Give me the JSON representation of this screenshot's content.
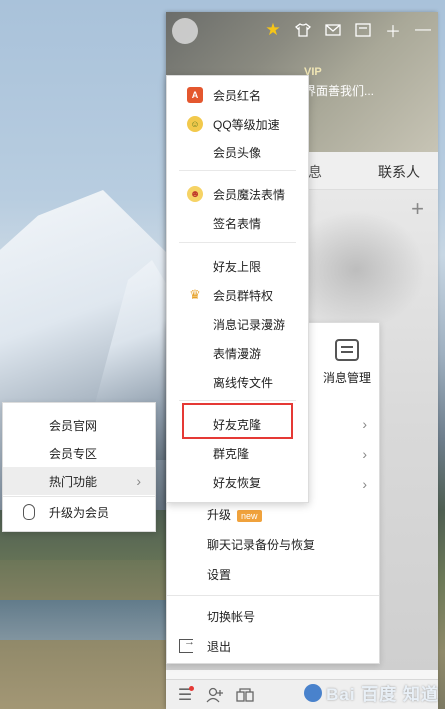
{
  "window": {
    "titlebar_icons": [
      "star-icon",
      "shirt-icon",
      "mail-icon",
      "mailbox-icon",
      "plus-icon",
      "minimize-icon"
    ],
    "vip_tag": "VIP",
    "signature": "界面善我们...",
    "tab_partial": "息",
    "tab_contacts": "联系人"
  },
  "main_menu": {
    "message_manager": "消息管理",
    "items": [
      {
        "label": "",
        "has_submenu": true
      },
      {
        "label": "",
        "has_submenu": true
      },
      {
        "label": "",
        "has_submenu": true
      },
      {
        "label": "升级",
        "badge": "new"
      },
      {
        "label": "聊天记录备份与恢复"
      },
      {
        "label": "设置"
      },
      {
        "label": "切换帐号"
      },
      {
        "label": "退出"
      }
    ]
  },
  "left_menu": {
    "items": [
      {
        "label": "会员官网"
      },
      {
        "label": "会员专区"
      },
      {
        "label": "热门功能",
        "has_submenu": true
      },
      {
        "label": "升级为会员"
      }
    ]
  },
  "sub_menu": {
    "items": [
      {
        "label": "会员红名",
        "icon": "red-name-icon"
      },
      {
        "label": "QQ等级加速",
        "icon": "level-speedup-icon"
      },
      {
        "label": "会员头像"
      },
      {
        "label": "会员魔法表情",
        "icon": "magic-emoji-icon"
      },
      {
        "label": "签名表情"
      },
      {
        "label": "好友上限"
      },
      {
        "label": "会员群特权",
        "icon": "crown-icon"
      },
      {
        "label": "消息记录漫游"
      },
      {
        "label": "表情漫游"
      },
      {
        "label": "离线传文件"
      },
      {
        "label": "好友克隆"
      },
      {
        "label": "群克隆"
      },
      {
        "label": "好友恢复"
      }
    ],
    "highlighted": "好友克隆",
    "highlight_color": "#e53935"
  },
  "watermark": {
    "text": "Bai 百度 知道"
  }
}
